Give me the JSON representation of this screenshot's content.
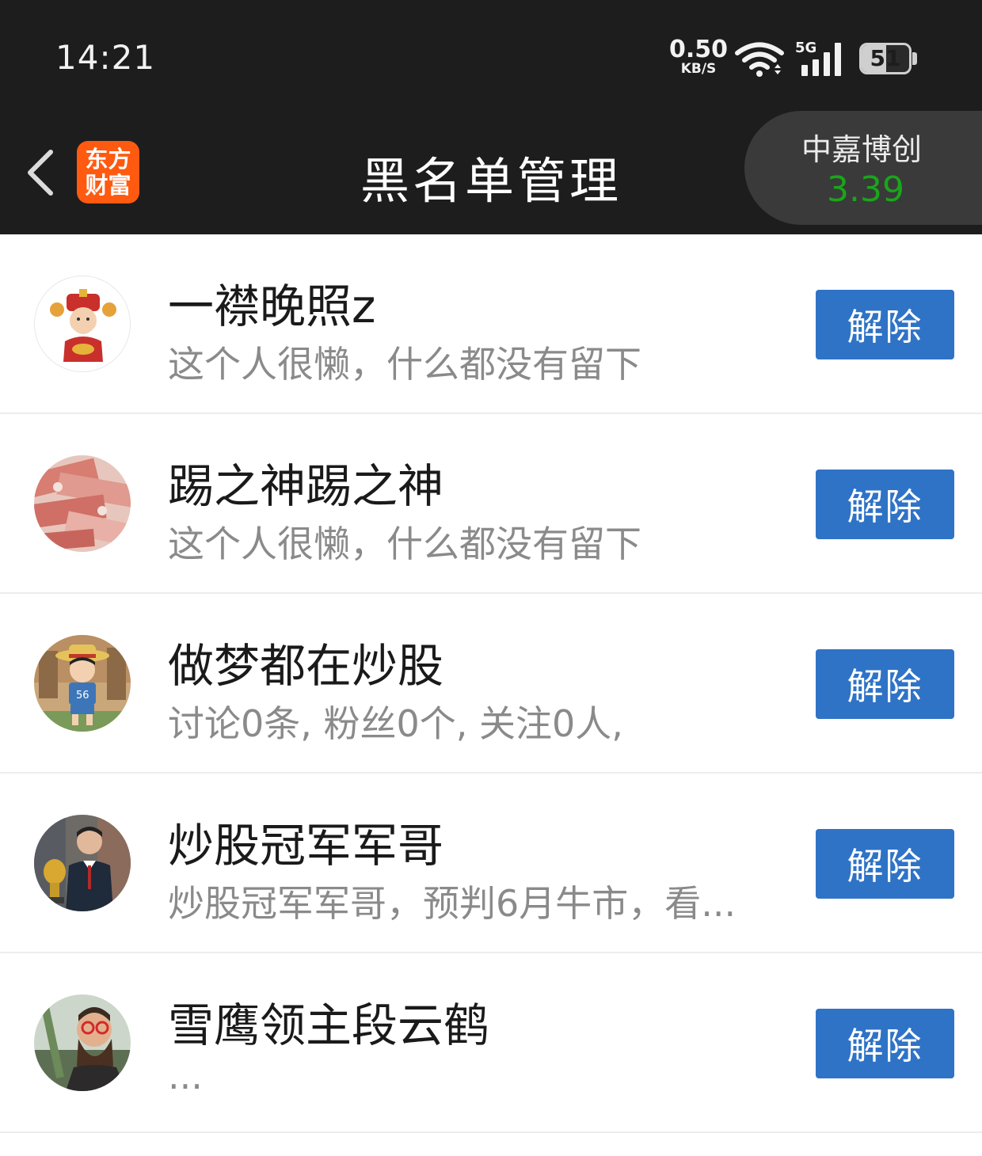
{
  "status_bar": {
    "time": "14:21",
    "net_speed_value": "0.50",
    "net_speed_unit": "KB/S",
    "network_type": "5G",
    "battery_level": "51",
    "battery_fraction": 0.51
  },
  "header": {
    "title": "黑名单管理",
    "logo_line1": "东方",
    "logo_line2": "财富",
    "stock_name": "中嘉博创",
    "stock_price": "3.39",
    "stock_price_color": "#1aa51a"
  },
  "blacklist": [
    {
      "name": "一襟晚照z",
      "desc": "这个人很懒，什么都没有留下",
      "button": "解除",
      "avatar": "god-of-wealth-avatar"
    },
    {
      "name": "踢之神踢之神",
      "desc": "这个人很懒，什么都没有留下",
      "button": "解除",
      "avatar": "money-stack-avatar"
    },
    {
      "name": "做梦都在炒股",
      "desc": "讨论0条, 粉丝0个, 关注0人,",
      "button": "解除",
      "avatar": "cartoon-boy-avatar"
    },
    {
      "name": "炒股冠军军哥",
      "desc": "炒股冠军军哥，预判6月牛市，看...",
      "button": "解除",
      "avatar": "trophy-man-avatar"
    },
    {
      "name": "雪鹰领主段云鹤",
      "desc": "...",
      "button": "解除",
      "avatar": "bearded-man-avatar"
    }
  ],
  "colors": {
    "bar_background": "#1d1d1d",
    "button_blue": "#2f73c6",
    "logo_orange": "#ff5a10"
  }
}
